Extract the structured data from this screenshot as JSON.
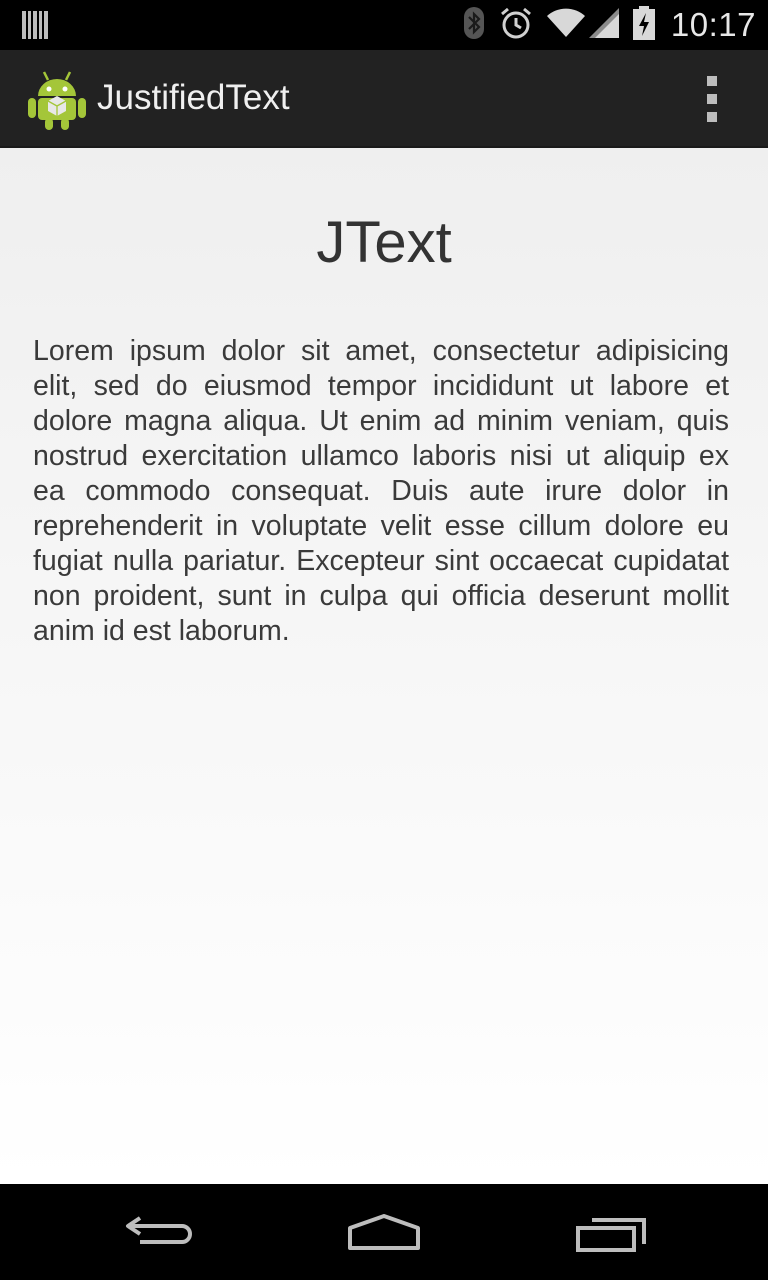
{
  "status_bar": {
    "time": "10:17",
    "icons": [
      "barcode-notification-icon",
      "bluetooth-icon",
      "alarm-icon",
      "wifi-icon",
      "cell-signal-icon",
      "battery-charging-icon"
    ]
  },
  "action_bar": {
    "title": "JustifiedText",
    "app_icon": "android-robot-icon",
    "overflow_icon": "overflow-menu-icon"
  },
  "main": {
    "heading": "JText",
    "paragraph": "Lorem ipsum dolor sit amet, consectetur adipisicing elit, sed do eiusmod tempor incididunt ut labore et dolore magna aliqua. Ut enim ad minim veniam, quis nostrud exercitation ullamco laboris nisi ut aliquip ex ea commodo consequat. Duis aute irure dolor in reprehenderit in voluptate velit esse cillum dolore eu fugiat nulla pariatur. Excepteur sint occaecat cupidatat non proident, sunt in culpa qui officia deserunt mollit anim id est laborum."
  },
  "nav_bar": {
    "icons": [
      "back-icon",
      "home-icon",
      "recent-apps-icon"
    ]
  },
  "colors": {
    "action_bar_bg": "#222222",
    "status_bar_bg": "#000000",
    "android_green": "#a4c639",
    "text": "#3a3a3a"
  }
}
